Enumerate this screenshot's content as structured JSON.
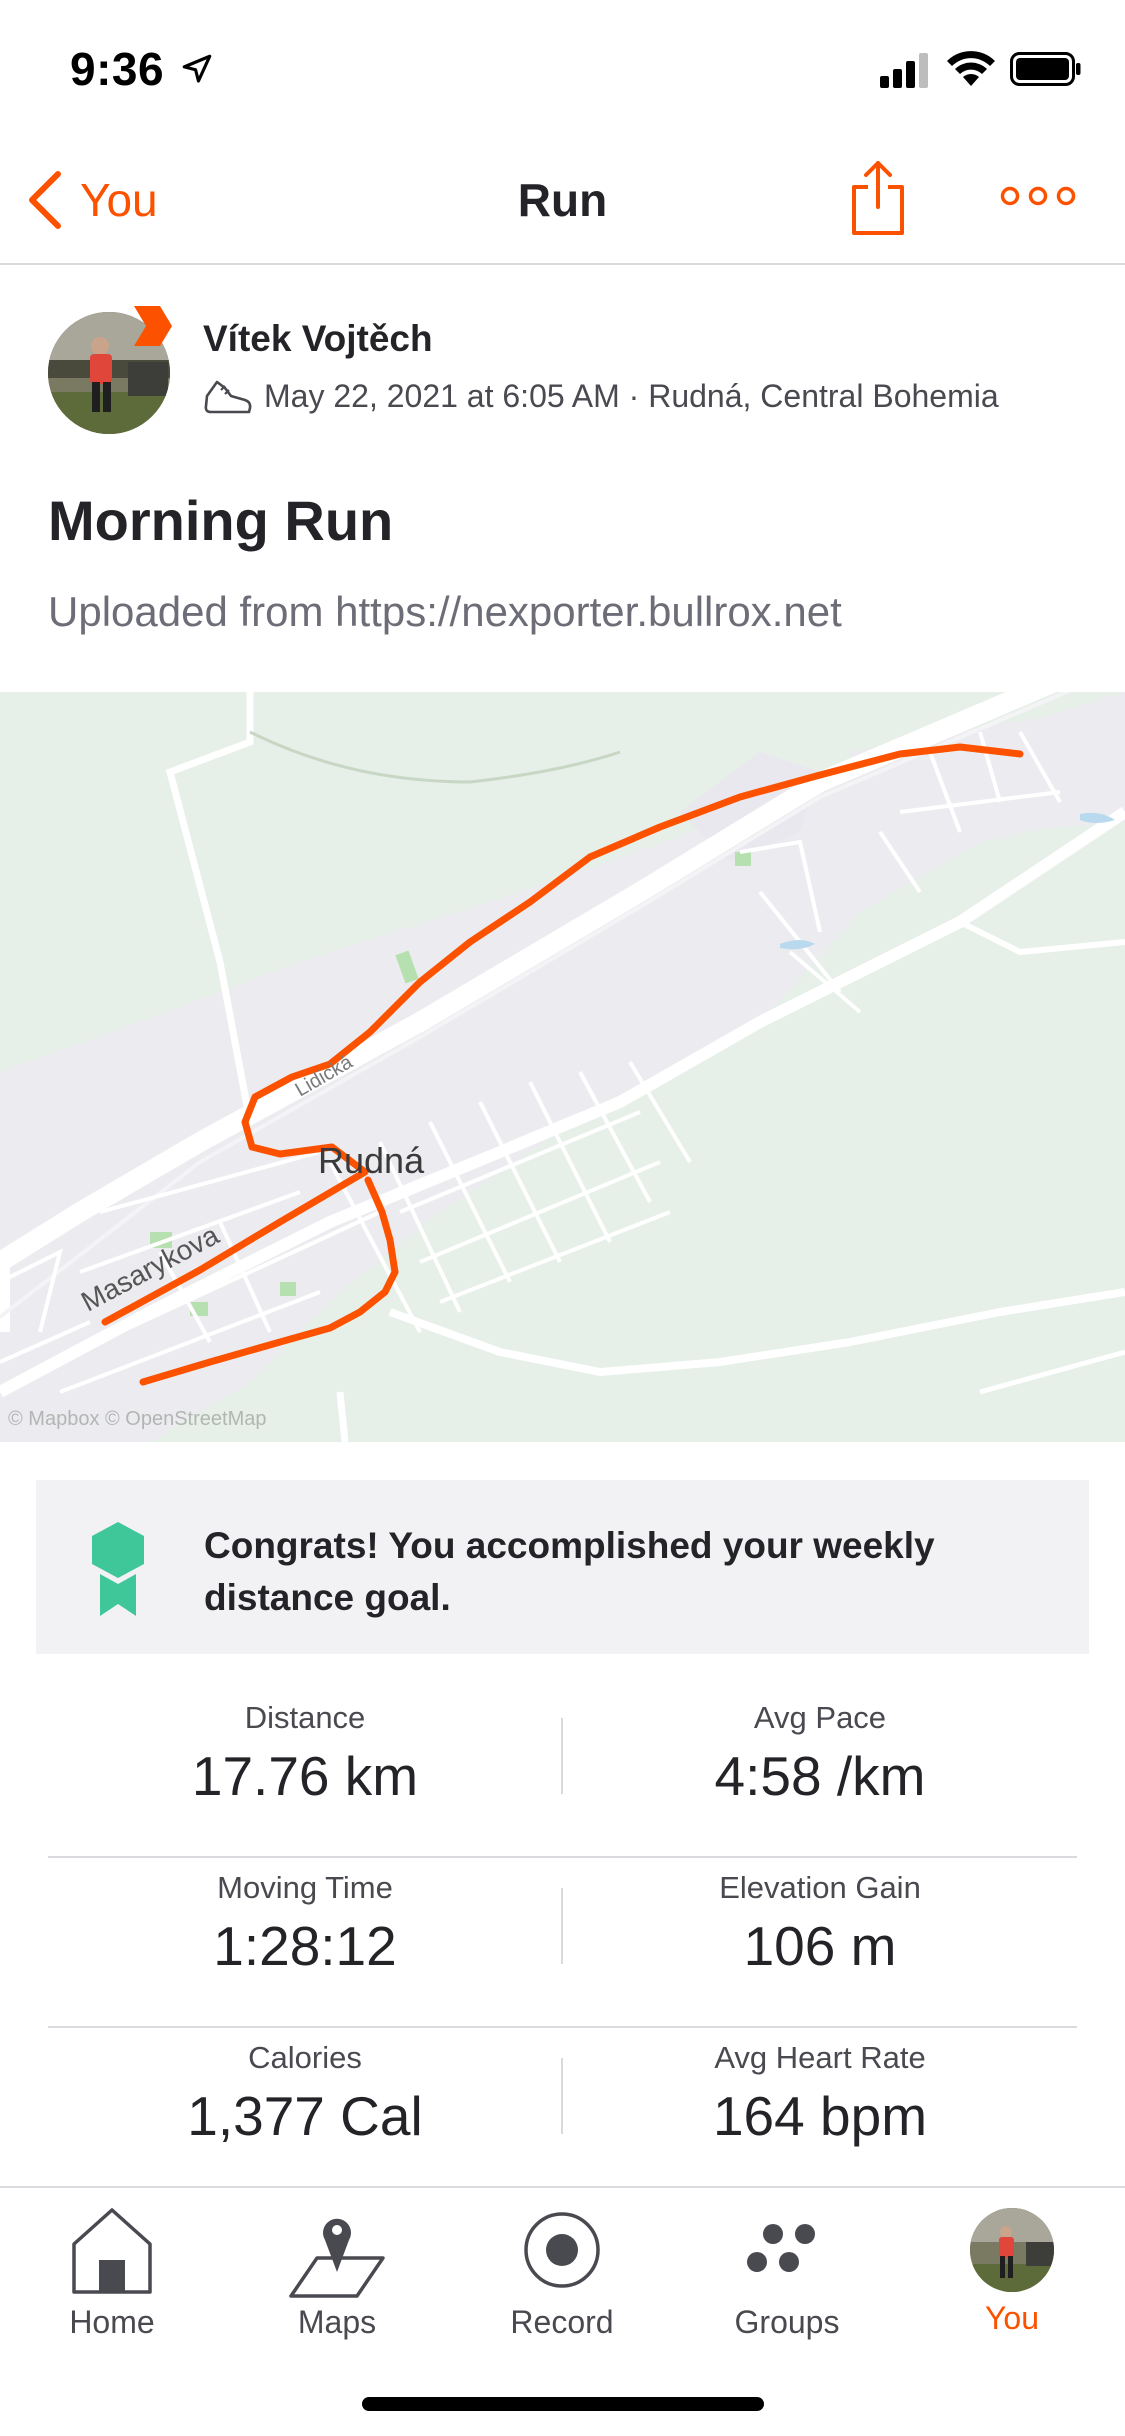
{
  "status_bar": {
    "time": "9:36"
  },
  "nav": {
    "back_label": "You",
    "title": "Run"
  },
  "athlete": {
    "name": "Vítek Vojtěch"
  },
  "activity": {
    "meta": "May 22, 2021 at 6:05 AM · Rudná, Central Bohemia",
    "title": "Morning Run",
    "description": "Uploaded from https://nexporter.bullrox.net"
  },
  "map": {
    "place_label": "Rudná",
    "street_label": "Masarykova",
    "attribution": "© Mapbox © OpenStreetMap",
    "route_color": "#fc5200"
  },
  "goal": {
    "text": "Congrats! You accomplished your weekly distance goal.",
    "badge_color": "#3fc79a"
  },
  "stats": [
    {
      "left": {
        "label": "Distance",
        "value": "17.76 km"
      },
      "right": {
        "label": "Avg Pace",
        "value": "4:58 /km"
      }
    },
    {
      "left": {
        "label": "Moving Time",
        "value": "1:28:12"
      },
      "right": {
        "label": "Elevation Gain",
        "value": "106 m"
      }
    },
    {
      "left": {
        "label": "Calories",
        "value": "1,377 Cal"
      },
      "right": {
        "label": "Avg Heart Rate",
        "value": "164 bpm"
      }
    }
  ],
  "tabs": [
    {
      "label": "Home",
      "icon": "home-icon"
    },
    {
      "label": "Maps",
      "icon": "maps-icon"
    },
    {
      "label": "Record",
      "icon": "record-icon"
    },
    {
      "label": "Groups",
      "icon": "groups-icon"
    },
    {
      "label": "You",
      "icon": "avatar",
      "active": true
    }
  ],
  "colors": {
    "accent": "#fc5200",
    "text": "#242428",
    "secondary": "#494950"
  }
}
